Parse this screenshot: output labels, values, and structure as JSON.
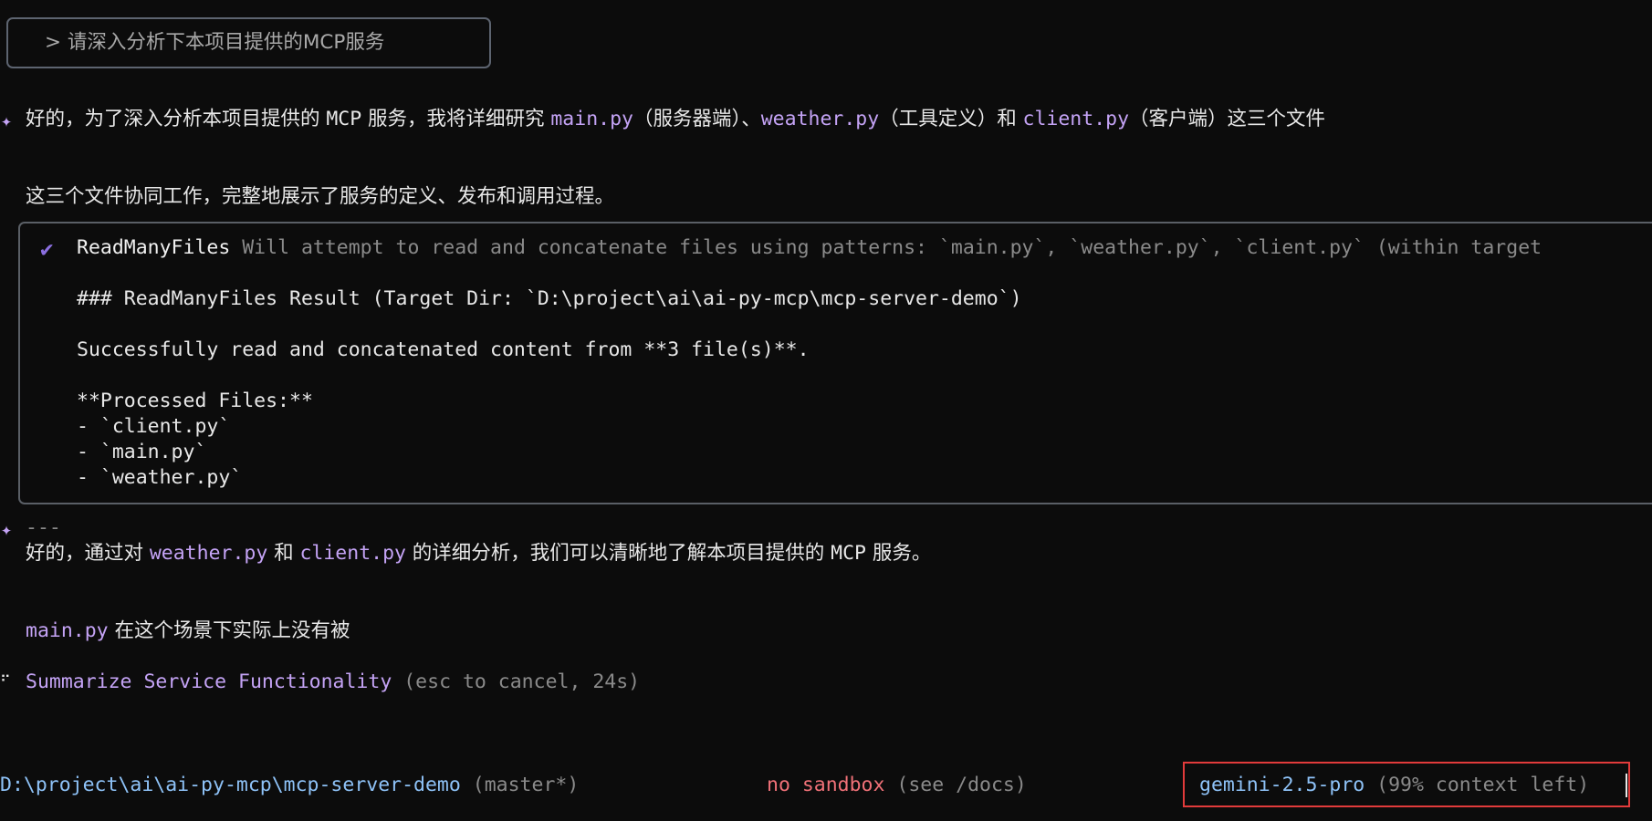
{
  "prompt": {
    "text": "> 请深入分析下本项目提供的MCP服务"
  },
  "intro": {
    "icon": "sparkle-icon",
    "segments": [
      {
        "text": "好的，为了深入分析本项目提供的 ",
        "style": "cjk"
      },
      {
        "text": "MCP",
        "style": "mono"
      },
      {
        "text": " 服务，我将详细研究 ",
        "style": "cjk"
      },
      {
        "text": "main.py",
        "style": "code"
      },
      {
        "text": "（服务器端）、",
        "style": "cjk"
      },
      {
        "text": "weather.py",
        "style": "code"
      },
      {
        "text": "（工具定义）和 ",
        "style": "cjk"
      },
      {
        "text": "client.py",
        "style": "code"
      },
      {
        "text": "（客户端）这三个文件",
        "style": "cjk"
      }
    ],
    "line2": "这三个文件协同工作，完整地展示了服务的定义、发布和调用过程。"
  },
  "tool_call": {
    "status_icon": "checkmark-icon",
    "name": "ReadManyFiles",
    "description": "Will attempt to read and concatenate files using patterns: `main.py`, `weather.py`, `client.py` (within target",
    "result_heading": "### ReadManyFiles Result (Target Dir: `D:\\project\\ai\\ai-py-mcp\\mcp-server-demo`)",
    "summary": "Successfully read and concatenated content from **3 file(s)**.",
    "processed_label": "**Processed Files:**",
    "files": [
      "- `client.py`",
      "- `main.py`",
      "- `weather.py`"
    ]
  },
  "response": {
    "icon": "sparkle-icon",
    "separator": "---",
    "line1_segments": [
      {
        "text": "好的，通过对 ",
        "style": "cjk"
      },
      {
        "text": "weather.py",
        "style": "code"
      },
      {
        "text": " 和 ",
        "style": "cjk"
      },
      {
        "text": "client.py",
        "style": "code"
      },
      {
        "text": " 的详细分析，我们可以清晰地了解本项目提供的 ",
        "style": "cjk"
      },
      {
        "text": "MCP",
        "style": "mono"
      },
      {
        "text": " 服务。",
        "style": "cjk"
      }
    ],
    "line2_code": "main.py",
    "line2_text": " 在这个场景下实际上没有被"
  },
  "progress": {
    "spinner_icon": "braille-spinner-icon",
    "title": "Summarize Service Functionality",
    "hint": "(esc to cancel, 24s)"
  },
  "status_bar": {
    "path": "D:\\project\\ai\\ai-py-mcp\\mcp-server-demo",
    "branch": "(master*)",
    "sandbox": "no sandbox",
    "sandbox_hint": "(see /docs)",
    "model": "gemini-2.5-pro",
    "context": "(99% context left)"
  },
  "colors": {
    "background": "#0c0c0c",
    "code_accent": "#c4a3f5",
    "path_blue": "#8ec2f7",
    "sandbox_red": "#f07178",
    "highlight_border": "#e23b3b",
    "check_purple": "#8b6fe0"
  }
}
